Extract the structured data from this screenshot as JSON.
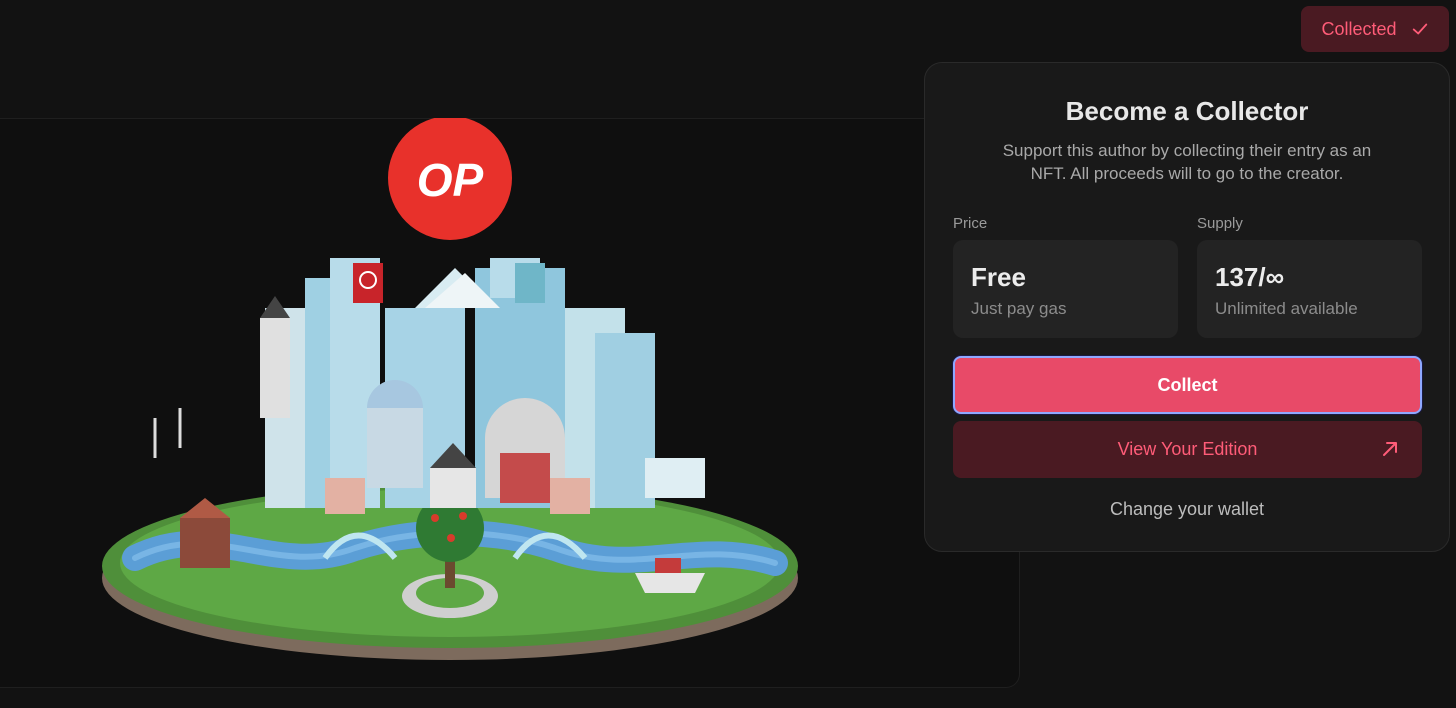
{
  "header": {
    "collected_label": "Collected",
    "collected_icon": "check-icon"
  },
  "hero": {
    "badge_text": "OP",
    "badge_color": "#e8312b",
    "artwork_icon": "floating-island-city-illustration"
  },
  "collector_panel": {
    "title": "Become a Collector",
    "description": "Support this author by collecting their entry as an NFT. All proceeds will to go to the creator.",
    "price": {
      "label": "Price",
      "value": "Free",
      "sub": "Just pay gas"
    },
    "supply": {
      "label": "Supply",
      "value": "137/∞",
      "sub": "Unlimited available"
    },
    "collect_label": "Collect",
    "view_edition_label": "View Your Edition",
    "view_edition_icon": "external-arrow-icon",
    "change_wallet_label": "Change your wallet"
  },
  "colors": {
    "accent": "#e84a68",
    "accent_dark": "#4a1a22",
    "accent_text": "#ff5c78",
    "focus_ring": "#8fa8ff"
  }
}
